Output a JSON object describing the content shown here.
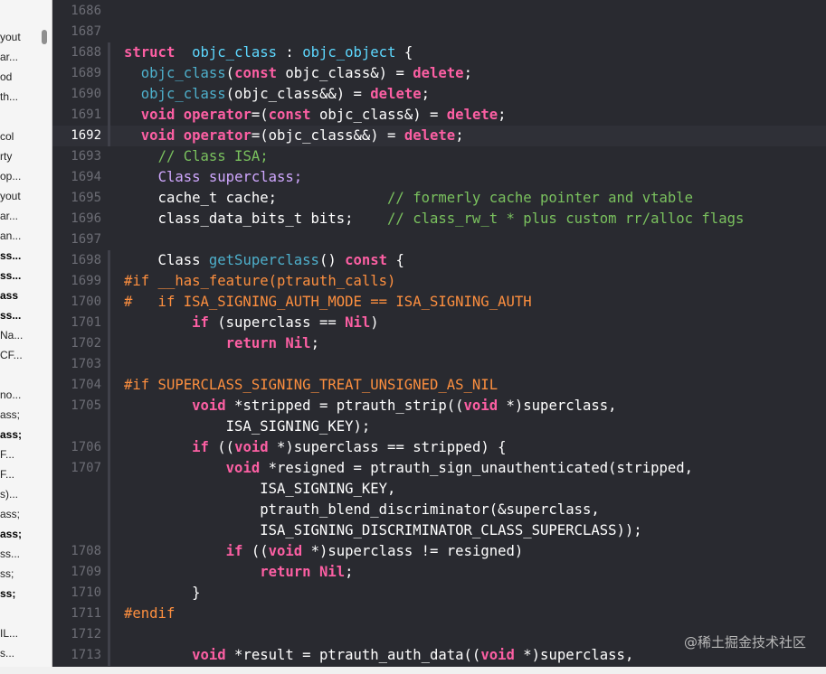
{
  "sidebar": {
    "items": [
      {
        "label": "yout",
        "bold": false
      },
      {
        "label": "ar...",
        "bold": false
      },
      {
        "label": "od",
        "bold": false
      },
      {
        "label": "th...",
        "bold": false
      },
      {
        "label": "",
        "bold": false
      },
      {
        "label": "col",
        "bold": false
      },
      {
        "label": "rty",
        "bold": false
      },
      {
        "label": "op...",
        "bold": false
      },
      {
        "label": "yout",
        "bold": false
      },
      {
        "label": "ar...",
        "bold": false
      },
      {
        "label": "an...",
        "bold": false
      },
      {
        "label": "ss...",
        "bold": true
      },
      {
        "label": "ss...",
        "bold": true
      },
      {
        "label": "ass",
        "bold": true
      },
      {
        "label": "ss...",
        "bold": true
      },
      {
        "label": "Na...",
        "bold": false
      },
      {
        "label": "CF...",
        "bold": false
      },
      {
        "label": "",
        "bold": false
      },
      {
        "label": "no...",
        "bold": false
      },
      {
        "label": "ass;",
        "bold": false
      },
      {
        "label": "ass;",
        "bold": true
      },
      {
        "label": "F...",
        "bold": false
      },
      {
        "label": "F...",
        "bold": false
      },
      {
        "label": "s)...",
        "bold": false
      },
      {
        "label": "ass;",
        "bold": false
      },
      {
        "label": "ass;",
        "bold": true
      },
      {
        "label": "ss...",
        "bold": false
      },
      {
        "label": "ss;",
        "bold": false
      },
      {
        "label": "ss;",
        "bold": true
      },
      {
        "label": "",
        "bold": false
      },
      {
        "label": "IL...",
        "bold": false
      },
      {
        "label": "s...",
        "bold": false
      }
    ]
  },
  "editor": {
    "current_line": "1692",
    "lines": [
      {
        "n": "1686",
        "tokens": []
      },
      {
        "n": "1687",
        "tokens": []
      },
      {
        "n": "1688",
        "tokens": [
          [
            "kw",
            "struct"
          ],
          [
            "",
            "  "
          ],
          [
            "dk",
            "objc_class"
          ],
          [
            "",
            " : "
          ],
          [
            "dk",
            "objc_object"
          ],
          [
            "",
            " {"
          ]
        ]
      },
      {
        "n": "1689",
        "tokens": [
          [
            "",
            "  "
          ],
          [
            "lib",
            "objc_class"
          ],
          [
            "",
            "("
          ],
          [
            "kw",
            "const"
          ],
          [
            "",
            " objc_class&) = "
          ],
          [
            "kw",
            "delete"
          ],
          [
            "",
            ";"
          ]
        ]
      },
      {
        "n": "1690",
        "tokens": [
          [
            "",
            "  "
          ],
          [
            "lib",
            "objc_class"
          ],
          [
            "",
            "(objc_class&&) = "
          ],
          [
            "kw",
            "delete"
          ],
          [
            "",
            ";"
          ]
        ]
      },
      {
        "n": "1691",
        "tokens": [
          [
            "",
            "  "
          ],
          [
            "kw",
            "void"
          ],
          [
            "",
            " "
          ],
          [
            "kw",
            "operator"
          ],
          [
            "",
            "=("
          ],
          [
            "kw",
            "const"
          ],
          [
            "",
            " objc_class&) = "
          ],
          [
            "kw",
            "delete"
          ],
          [
            "",
            ";"
          ]
        ]
      },
      {
        "n": "1692",
        "tokens": [
          [
            "",
            "  "
          ],
          [
            "kw",
            "void"
          ],
          [
            "",
            " "
          ],
          [
            "kw",
            "operator"
          ],
          [
            "",
            "=(objc_class&&) = "
          ],
          [
            "kw",
            "delete"
          ],
          [
            "",
            ";"
          ]
        ]
      },
      {
        "n": "1693",
        "tokens": [
          [
            "",
            "    "
          ],
          [
            "cm2",
            "// Class ISA;"
          ]
        ]
      },
      {
        "n": "1694",
        "tokens": [
          [
            "",
            "    "
          ],
          [
            "tyb",
            "Class"
          ],
          [
            "tyb",
            " superclass;"
          ]
        ]
      },
      {
        "n": "1695",
        "tokens": [
          [
            "",
            "    cache_t cache;             "
          ],
          [
            "cm2",
            "// formerly cache pointer and vtable"
          ]
        ]
      },
      {
        "n": "1696",
        "tokens": [
          [
            "",
            "    class_data_bits_t bits;    "
          ],
          [
            "cm2",
            "// class_rw_t * plus custom rr/alloc flags"
          ]
        ]
      },
      {
        "n": "1697",
        "tokens": []
      },
      {
        "n": "1698",
        "tokens": [
          [
            "",
            "    Class "
          ],
          [
            "lib",
            "getSuperclass"
          ],
          [
            "",
            "() "
          ],
          [
            "kw",
            "const"
          ],
          [
            "",
            " {"
          ]
        ]
      },
      {
        "n": "1699",
        "tokens": [
          [
            "pp",
            "#if __has_feature(ptrauth_calls)"
          ]
        ]
      },
      {
        "n": "1700",
        "tokens": [
          [
            "pp",
            "#   if ISA_SIGNING_AUTH_MODE == ISA_SIGNING_AUTH"
          ]
        ]
      },
      {
        "n": "1701",
        "tokens": [
          [
            "",
            "        "
          ],
          [
            "kw",
            "if"
          ],
          [
            "",
            " (superclass == "
          ],
          [
            "kw",
            "Nil"
          ],
          [
            "",
            ")"
          ]
        ]
      },
      {
        "n": "1702",
        "tokens": [
          [
            "",
            "            "
          ],
          [
            "kw",
            "return"
          ],
          [
            "",
            " "
          ],
          [
            "kw",
            "Nil"
          ],
          [
            "",
            ";"
          ]
        ]
      },
      {
        "n": "1703",
        "tokens": []
      },
      {
        "n": "1704",
        "tokens": [
          [
            "pp",
            "#if SUPERCLASS_SIGNING_TREAT_UNSIGNED_AS_NIL"
          ]
        ]
      },
      {
        "n": "1705",
        "tokens": [
          [
            "",
            "        "
          ],
          [
            "kw",
            "void"
          ],
          [
            "",
            " *stripped = ptrauth_strip(("
          ],
          [
            "kw",
            "void"
          ],
          [
            "",
            " *)superclass,"
          ]
        ]
      },
      {
        "n": "",
        "tokens": [
          [
            "",
            "            ISA_SIGNING_KEY);"
          ]
        ]
      },
      {
        "n": "1706",
        "tokens": [
          [
            "",
            "        "
          ],
          [
            "kw",
            "if"
          ],
          [
            "",
            " (("
          ],
          [
            "kw",
            "void"
          ],
          [
            "",
            " *)superclass == stripped) {"
          ]
        ]
      },
      {
        "n": "1707",
        "tokens": [
          [
            "",
            "            "
          ],
          [
            "kw",
            "void"
          ],
          [
            "",
            " *resigned = ptrauth_sign_unauthenticated(stripped,"
          ]
        ]
      },
      {
        "n": "",
        "tokens": [
          [
            "",
            "                ISA_SIGNING_KEY,"
          ]
        ]
      },
      {
        "n": "",
        "tokens": [
          [
            "",
            "                ptrauth_blend_discriminator(&superclass,"
          ]
        ]
      },
      {
        "n": "",
        "tokens": [
          [
            "",
            "                ISA_SIGNING_DISCRIMINATOR_CLASS_SUPERCLASS));"
          ]
        ]
      },
      {
        "n": "1708",
        "tokens": [
          [
            "",
            "            "
          ],
          [
            "kw",
            "if"
          ],
          [
            "",
            " (("
          ],
          [
            "kw",
            "void"
          ],
          [
            "",
            " *)superclass != resigned)"
          ]
        ]
      },
      {
        "n": "1709",
        "tokens": [
          [
            "",
            "                "
          ],
          [
            "kw",
            "return"
          ],
          [
            "",
            " "
          ],
          [
            "kw",
            "Nil"
          ],
          [
            "",
            ";"
          ]
        ]
      },
      {
        "n": "1710",
        "tokens": [
          [
            "",
            "        }"
          ]
        ]
      },
      {
        "n": "1711",
        "tokens": [
          [
            "pp",
            "#endif"
          ]
        ]
      },
      {
        "n": "1712",
        "tokens": []
      },
      {
        "n": "1713",
        "tokens": [
          [
            "",
            "        "
          ],
          [
            "kw",
            "void"
          ],
          [
            "",
            " *result = ptrauth_auth_data(("
          ],
          [
            "kw",
            "void"
          ],
          [
            "",
            " *)superclass,"
          ]
        ]
      }
    ]
  },
  "watermark": "@稀土掘金技术社区"
}
